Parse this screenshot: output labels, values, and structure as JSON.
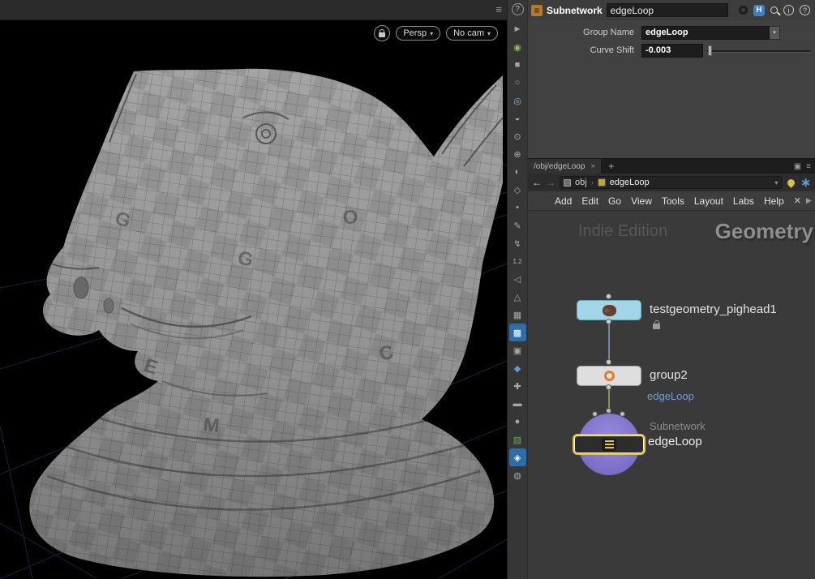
{
  "viewport": {
    "display_options_glyph": "≡",
    "help_glyph": "?",
    "persp_label": "Persp",
    "cam_label": "No cam",
    "dropdown_caret": "▾",
    "texture_letters": [
      "G",
      "O",
      "E",
      "M",
      "C",
      "G"
    ]
  },
  "toolbar": {
    "icons": [
      "►",
      "◉",
      "■",
      "○",
      "◎",
      "◒",
      "⊙",
      "⊕",
      "◐",
      "◇",
      "•",
      "✎",
      "↯",
      "1.2",
      "◁",
      "△",
      "▦",
      "▩",
      "▣",
      "◆",
      "✚",
      "▬",
      "●",
      "▧",
      "◈",
      "◍"
    ]
  },
  "param_pane": {
    "node_type": "Subnetwork",
    "node_name": "edgeLoop",
    "badge_letter": "H",
    "info_glyph": "i",
    "help_glyph": "?",
    "rows": [
      {
        "label": "Group Name",
        "value": "edgeLoop"
      },
      {
        "label": "Curve Shift",
        "value": "-0.003"
      }
    ]
  },
  "network": {
    "tab_label": "/obj/edgeLoop",
    "tab_close_glyph": "×",
    "new_tab_glyph": "+",
    "tabbar_icons": [
      "▣",
      "≡"
    ],
    "back_glyph": "←",
    "forward_glyph": "→",
    "crumb_root": "obj",
    "crumb_sep": "›",
    "crumb_current": "edgeLoop",
    "crumb_caret": "▾",
    "menus": [
      "Add",
      "Edit",
      "Go",
      "View",
      "Tools",
      "Layout",
      "Labs",
      "Help"
    ],
    "menubar_icons": [
      "✕",
      "▶"
    ],
    "watermark_edition": "Indie Edition",
    "watermark_context": "Geometry",
    "nodes": {
      "pighead_label": "testgeometry_pighead1",
      "group_label": "group2",
      "output_label": "edgeLoop",
      "subnet_type": "Subnetwork",
      "subnet_label": "edgeLoop"
    }
  },
  "colors": {
    "node_blue": "#a3d5e8",
    "node_white": "#dedede",
    "selection_yellow": "#e6c832",
    "subnet_purple": "#8679cf",
    "link_blue": "#6f9fd8"
  }
}
